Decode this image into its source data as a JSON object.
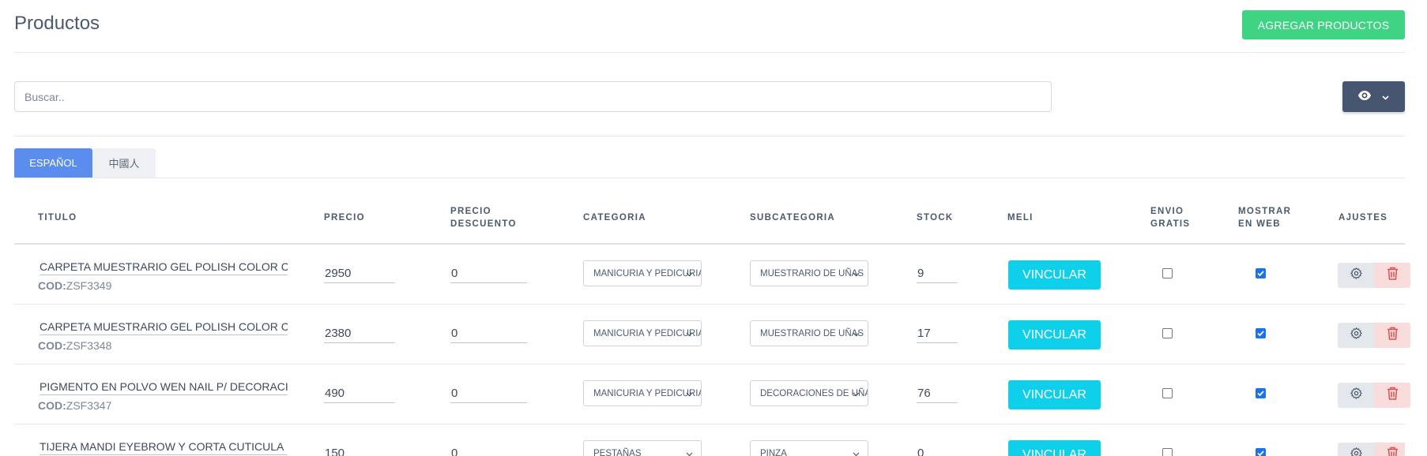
{
  "header": {
    "title": "Productos",
    "add_button_label": "AGREGAR PRODUCTOS"
  },
  "search": {
    "placeholder": "Buscar..",
    "value": ""
  },
  "view_button": {
    "icon": "eye-icon",
    "dropdown_icon": "chevron-down-icon"
  },
  "tabs": [
    {
      "label": "ESPAÑOL",
      "active": true
    },
    {
      "label": "中國人",
      "active": false
    }
  ],
  "table": {
    "columns": {
      "titulo": "TITULO",
      "precio": "PRECIO",
      "precio_descuento_1": "PRECIO",
      "precio_descuento_2": "DESCUENTO",
      "categoria": "CATEGORIA",
      "subcategoria": "SUBCATEGORIA",
      "stock": "STOCK",
      "meli": "MELI",
      "envio_1": "ENVIO",
      "envio_2": "GRATIS",
      "mostrar_1": "MOSTRAR",
      "mostrar_2": "EN WEB",
      "ajustes": "AJUSTES"
    },
    "code_prefix": "COD:",
    "link_label": "VINCULAR",
    "rows": [
      {
        "title": "CARPETA MUESTRARIO GEL POLISH COLOR CARD",
        "code": "ZSF3349",
        "price": "2950",
        "discount": "0",
        "category": "MANICURIA Y PEDICURIA",
        "subcategory": "MUESTRARIO DE UÑAS",
        "stock": "9",
        "free_shipping": false,
        "show_web": true
      },
      {
        "title": "CARPETA MUESTRARIO GEL POLISH COLOR CARD",
        "code": "ZSF3348",
        "price": "2380",
        "discount": "0",
        "category": "MANICURIA Y PEDICURIA",
        "subcategory": "MUESTRARIO DE UÑAS",
        "stock": "17",
        "free_shipping": false,
        "show_web": true
      },
      {
        "title": "PIGMENTO EN POLVO WEN NAIL P/ DECORACION",
        "code": "ZSF3347",
        "price": "490",
        "discount": "0",
        "category": "MANICURIA Y PEDICURIA",
        "subcategory": "DECORACIONES DE UÑAS",
        "stock": "76",
        "free_shipping": false,
        "show_web": true
      },
      {
        "title": "TIJERA MANDI EYEBROW Y CORTA CUTICULA",
        "code": "",
        "price": "150",
        "discount": "0",
        "category": "PESTAÑAS",
        "subcategory": "PINZA",
        "stock": "0",
        "free_shipping": false,
        "show_web": true
      }
    ]
  },
  "colors": {
    "add_button": "#3fd384",
    "view_button": "#465670",
    "active_tab": "#5b8def",
    "link_button": "#0fd0ea",
    "delete_button_bg": "#f9dcdc",
    "delete_icon": "#d9534f"
  }
}
